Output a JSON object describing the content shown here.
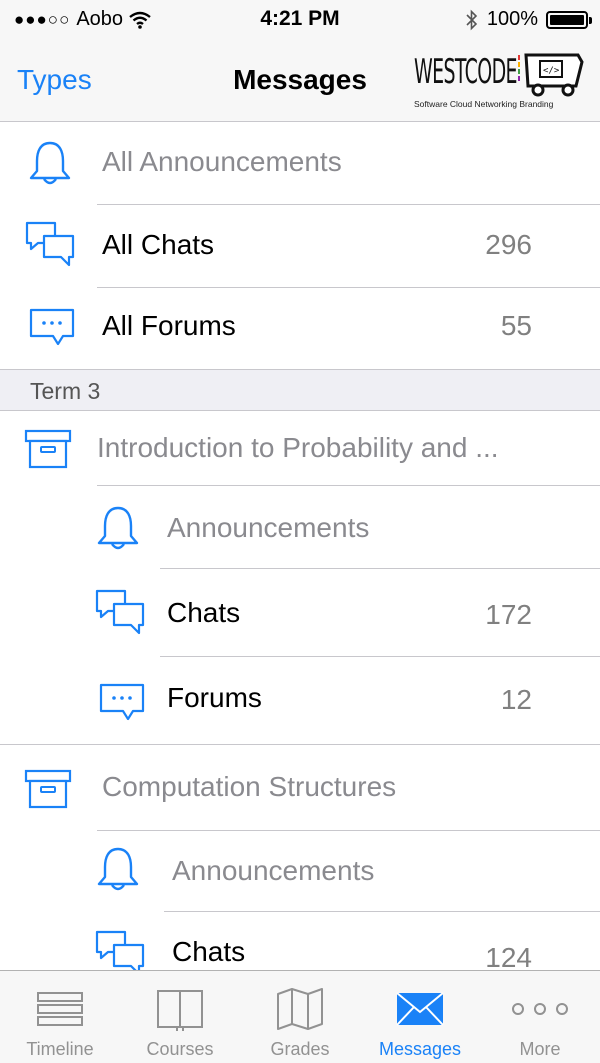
{
  "status_bar": {
    "signal": "●●●○○",
    "carrier": "Aobo",
    "time": "4:21 PM",
    "battery": "100%"
  },
  "nav": {
    "back_label": "Types",
    "title": "Messages",
    "logo": {
      "word": "WESTCODE",
      "tagline": "Software  Cloud  Networking  Branding"
    }
  },
  "top_items": [
    {
      "label": "All Announcements",
      "count": "",
      "icon": "bell-icon"
    },
    {
      "label": "All Chats",
      "count": "296",
      "icon": "chat-bubbles-icon"
    },
    {
      "label": "All Forums",
      "count": "55",
      "icon": "forum-bubble-icon"
    }
  ],
  "section": {
    "title": "Term 3"
  },
  "courses": [
    {
      "title": "Introduction to Probability and ...",
      "items": [
        {
          "label": "Announcements",
          "count": ""
        },
        {
          "label": "Chats",
          "count": "172"
        },
        {
          "label": "Forums",
          "count": "12"
        }
      ]
    },
    {
      "title": "Computation Structures",
      "items": [
        {
          "label": "Announcements",
          "count": ""
        },
        {
          "label": "Chats",
          "count": "124"
        }
      ]
    }
  ],
  "tabs": [
    {
      "label": "Timeline",
      "icon": "timeline-icon",
      "active": false
    },
    {
      "label": "Courses",
      "icon": "book-icon",
      "active": false
    },
    {
      "label": "Grades",
      "icon": "map-icon",
      "active": false
    },
    {
      "label": "Messages",
      "icon": "envelope-icon",
      "active": true
    },
    {
      "label": "More",
      "icon": "more-dots-icon",
      "active": false
    }
  ],
  "colors": {
    "accent": "#1a82f7",
    "muted_text": "#8a8a8f",
    "count_text": "#808080",
    "section_bg": "#efeff4"
  }
}
